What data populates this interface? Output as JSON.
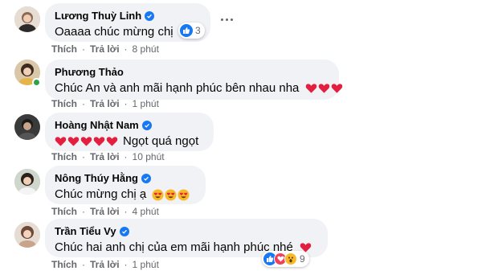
{
  "comments": [
    {
      "name": "Lương Thuỳ Linh",
      "verified": true,
      "text": "Oaaaa chúc mừng chị",
      "reaction_count": "3",
      "like": "Thích",
      "reply": "Trả lời",
      "time": "8 phút"
    },
    {
      "name": "Phương Thảo",
      "verified": false,
      "text": "Chúc An và anh mãi hạnh phúc bên nhau nha",
      "emoji": [
        "red-heart",
        "red-heart",
        "red-heart"
      ],
      "like": "Thích",
      "reply": "Trả lời",
      "time": "1 phút"
    },
    {
      "name": "Hoàng Nhật Nam",
      "verified": true,
      "text": "Ngọt quá ngọt",
      "emoji": [
        "red-heart",
        "red-heart",
        "red-heart",
        "red-heart",
        "red-heart"
      ],
      "like": "Thích",
      "reply": "Trả lời",
      "time": "10 phút"
    },
    {
      "name": "Nông Thúy Hằng",
      "verified": true,
      "text": "Chúc mừng chị ạ",
      "emoji": [
        "heart-eyes",
        "heart-eyes",
        "heart-eyes"
      ],
      "like": "Thích",
      "reply": "Trả lời",
      "time": "4 phút"
    },
    {
      "name": "Trần Tiểu Vy",
      "verified": true,
      "text": "Chúc hai anh chị của em mãi hạnh phúc nhé",
      "emoji": [
        "red-heart"
      ],
      "reaction_count": "9",
      "like": "Thích",
      "reply": "Trả lời",
      "time": "1 phút"
    }
  ],
  "colors": {
    "bubble": "#f0f2f5",
    "verified": "#1877f2",
    "meta": "#65676b",
    "heart": "#e41e3f",
    "online": "#31a24c"
  }
}
